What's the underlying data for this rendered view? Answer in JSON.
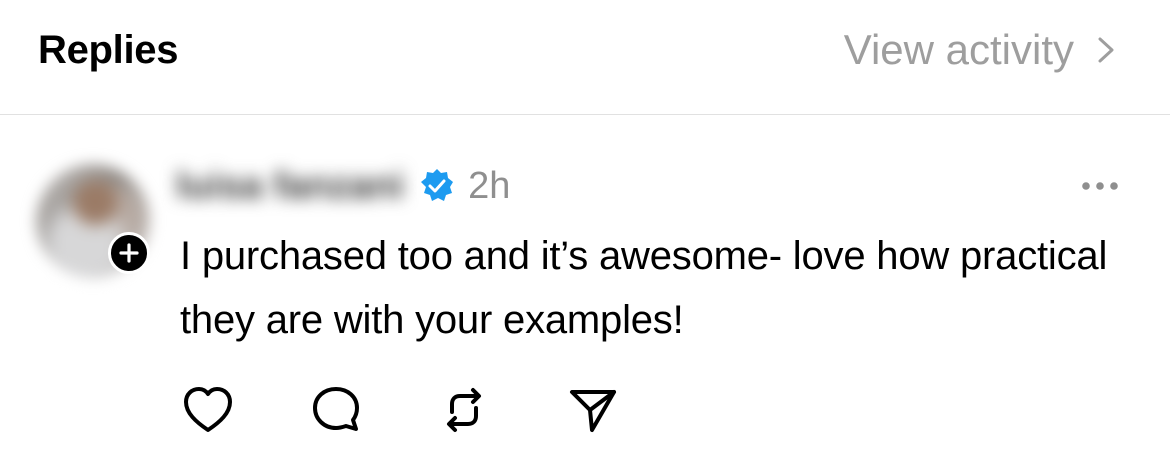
{
  "header": {
    "title": "Replies",
    "view_activity_label": "View activity"
  },
  "post": {
    "username": "luisa fanzani",
    "verified": true,
    "timestamp": "2h",
    "text": "I purchased too and it’s awesome- love how practical they are with your examples!",
    "actions": [
      "like-icon",
      "comment-icon",
      "repost-icon",
      "share-icon"
    ]
  },
  "colors": {
    "accent": "#1d9bf0",
    "muted": "#9e9e9e",
    "text": "#000000"
  }
}
